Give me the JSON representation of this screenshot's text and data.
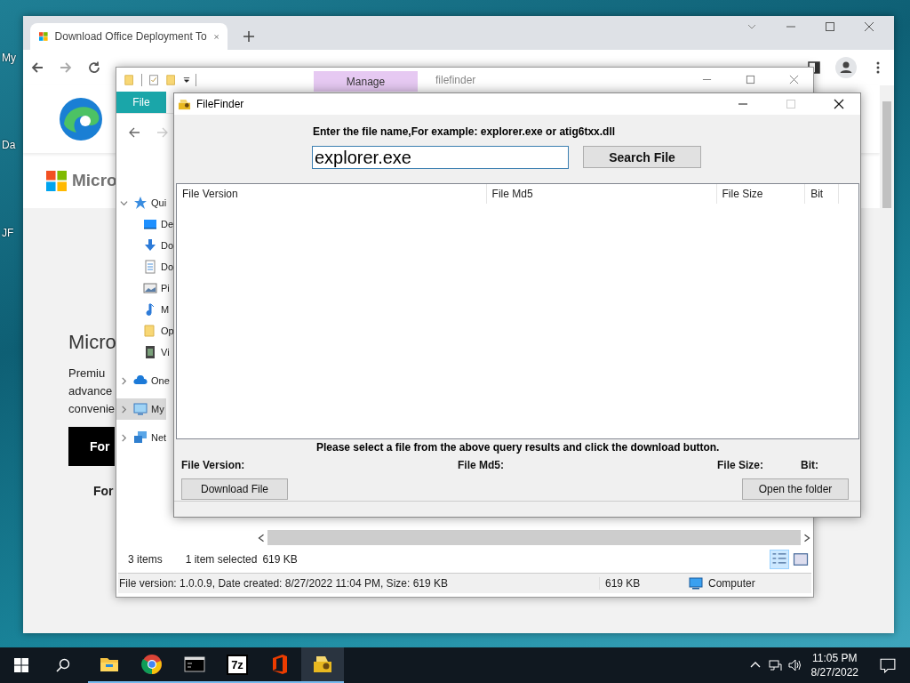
{
  "desktop": {
    "icons": [
      {
        "label": "My"
      },
      {
        "label": "Da"
      },
      {
        "label": "JF"
      }
    ]
  },
  "browser": {
    "tabs": [
      {
        "title": "Download Office Deployment To",
        "selected": true
      }
    ],
    "page": {
      "logo_text": "Micro",
      "heading": "Micro",
      "body_lines": [
        "Premiu",
        "advance",
        "convenie"
      ],
      "black_button": "For",
      "link": "For"
    }
  },
  "explorer": {
    "context_tab": "Manage",
    "title": "filefinder",
    "ribbon_tabs": [
      {
        "label": "File",
        "selected": true
      }
    ],
    "navigation": [
      {
        "label": "Qui",
        "kind": "star",
        "expanded": true,
        "selected": false,
        "children": [
          {
            "label": "De",
            "kind": "desktop",
            "selected": false
          },
          {
            "label": "Do",
            "kind": "download",
            "selected": false
          },
          {
            "label": "Do",
            "kind": "document",
            "selected": false
          },
          {
            "label": "Pi",
            "kind": "pictures",
            "selected": false
          },
          {
            "label": "M",
            "kind": "music",
            "selected": false
          },
          {
            "label": "Op",
            "kind": "folder",
            "selected": false
          },
          {
            "label": "Vi",
            "kind": "videos",
            "selected": false
          }
        ]
      },
      {
        "label": "One",
        "kind": "cloud",
        "expanded": false,
        "selected": false
      },
      {
        "label": "My",
        "kind": "computer",
        "expanded": false,
        "selected": true
      },
      {
        "label": "Net",
        "kind": "network",
        "expanded": false,
        "selected": false
      }
    ],
    "status": {
      "items": "3 items",
      "selection": "1 item selected",
      "size": "619 KB"
    },
    "details": {
      "info": "File version: 1.0.0.9, Date created: 8/27/2022 11:04 PM, Size: 619 KB",
      "size": "619 KB",
      "location": "Computer"
    }
  },
  "filefinder": {
    "title": "FileFinder",
    "prompt": "Enter the file name,For example: explorer.exe or atig6txx.dll",
    "search_value": "explorer.exe",
    "search_button": "Search File",
    "columns": [
      "File Version",
      "File Md5",
      "File Size",
      "Bit"
    ],
    "hint": "Please select a file from the above query results and click the download button.",
    "fields": [
      "File Version:",
      "File Md5:",
      "File Size:",
      "Bit:"
    ],
    "download_button": "Download File",
    "open_button": "Open the folder"
  },
  "taskbar": {
    "apps": [
      {
        "kind": "explorer",
        "running": true,
        "active": false
      },
      {
        "kind": "chrome",
        "running": true,
        "active": false
      },
      {
        "kind": "terminal",
        "running": true,
        "active": false
      },
      {
        "kind": "archiver",
        "label": "7z",
        "running": true,
        "active": false
      },
      {
        "kind": "office",
        "running": true,
        "active": false
      },
      {
        "kind": "filefinder",
        "running": true,
        "active": true
      }
    ],
    "time": "11:05 PM",
    "date": "8/27/2022"
  }
}
